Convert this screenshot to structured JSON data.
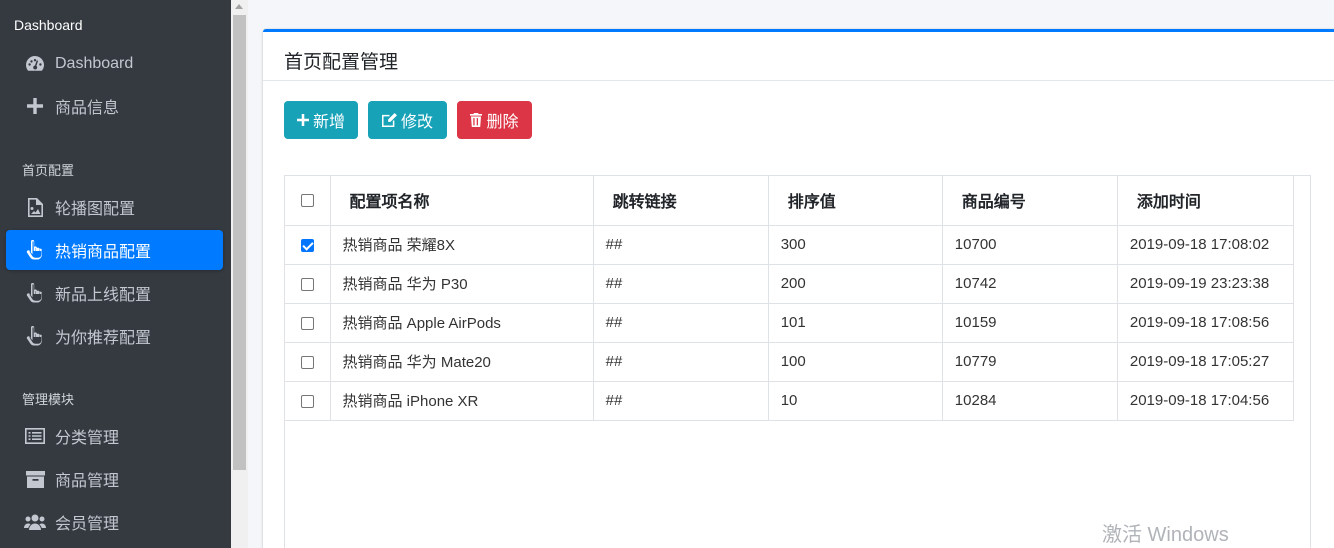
{
  "sidebar": {
    "header": "Dashboard",
    "items_top": [
      {
        "label": "Dashboard",
        "icon": "tachometer-icon"
      },
      {
        "label": "商品信息",
        "icon": "plus-icon"
      }
    ],
    "section_home": "首页配置",
    "items_home": [
      {
        "label": "轮播图配置",
        "icon": "image-file-icon"
      },
      {
        "label": "热销商品配置",
        "icon": "hand-pointer-icon",
        "active": true
      },
      {
        "label": "新品上线配置",
        "icon": "hand-pointer-icon"
      },
      {
        "label": "为你推荐配置",
        "icon": "hand-pointer-icon"
      }
    ],
    "section_manage": "管理模块",
    "items_manage": [
      {
        "label": "分类管理",
        "icon": "list-icon"
      },
      {
        "label": "商品管理",
        "icon": "archive-icon"
      },
      {
        "label": "会员管理",
        "icon": "users-icon"
      }
    ]
  },
  "card": {
    "title": "首页配置管理"
  },
  "toolbar": {
    "add_label": "新增",
    "edit_label": "修改",
    "delete_label": "删除"
  },
  "table": {
    "headers": [
      "配置项名称",
      "跳转链接",
      "排序值",
      "商品编号",
      "添加时间"
    ],
    "rows": [
      {
        "checked": true,
        "name": "热销商品 荣耀8X",
        "link": "##",
        "sort": "300",
        "goods_id": "10700",
        "time": "2019-09-18 17:08:02"
      },
      {
        "checked": false,
        "name": "热销商品 华为 P30",
        "link": "##",
        "sort": "200",
        "goods_id": "10742",
        "time": "2019-09-19 23:23:38"
      },
      {
        "checked": false,
        "name": "热销商品 Apple AirPods",
        "link": "##",
        "sort": "101",
        "goods_id": "10159",
        "time": "2019-09-18 17:08:56"
      },
      {
        "checked": false,
        "name": "热销商品 华为 Mate20",
        "link": "##",
        "sort": "100",
        "goods_id": "10779",
        "time": "2019-09-18 17:05:27"
      },
      {
        "checked": false,
        "name": "热销商品 iPhone XR",
        "link": "##",
        "sort": "10",
        "goods_id": "10284",
        "time": "2019-09-18 17:04:56"
      }
    ]
  },
  "watermark": "激活 Windows",
  "colors": {
    "sidebar_bg": "#343a40",
    "active_item": "#007bff",
    "info_button": "#17a2b8",
    "danger_button": "#dc3545"
  }
}
